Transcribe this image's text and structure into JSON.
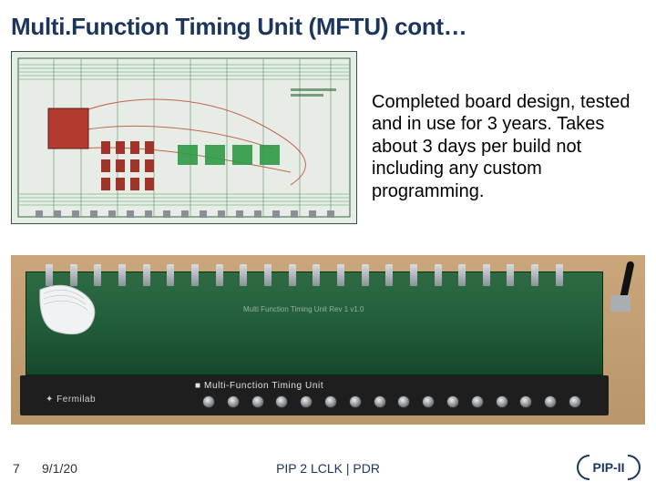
{
  "title": "Multi.Function Timing Unit (MFTU) cont…",
  "description": "Completed board design, tested and in use for 3 years. Takes about 3 days per build not including any custom programming.",
  "photo": {
    "panel_brand": "✦ Fermilab",
    "panel_label": "■ Multi-Function Timing Unit",
    "board_silk": "Multi Function Timing Unit  Rev 1  v1.0"
  },
  "footer": {
    "page": "7",
    "date": "9/1/20",
    "center": "PIP 2 LCLK | PDR",
    "logo_text": "PIP-II"
  },
  "images": {
    "layout_name": "pcb-layout-screenshot",
    "photo_name": "assembled-board-photo"
  }
}
